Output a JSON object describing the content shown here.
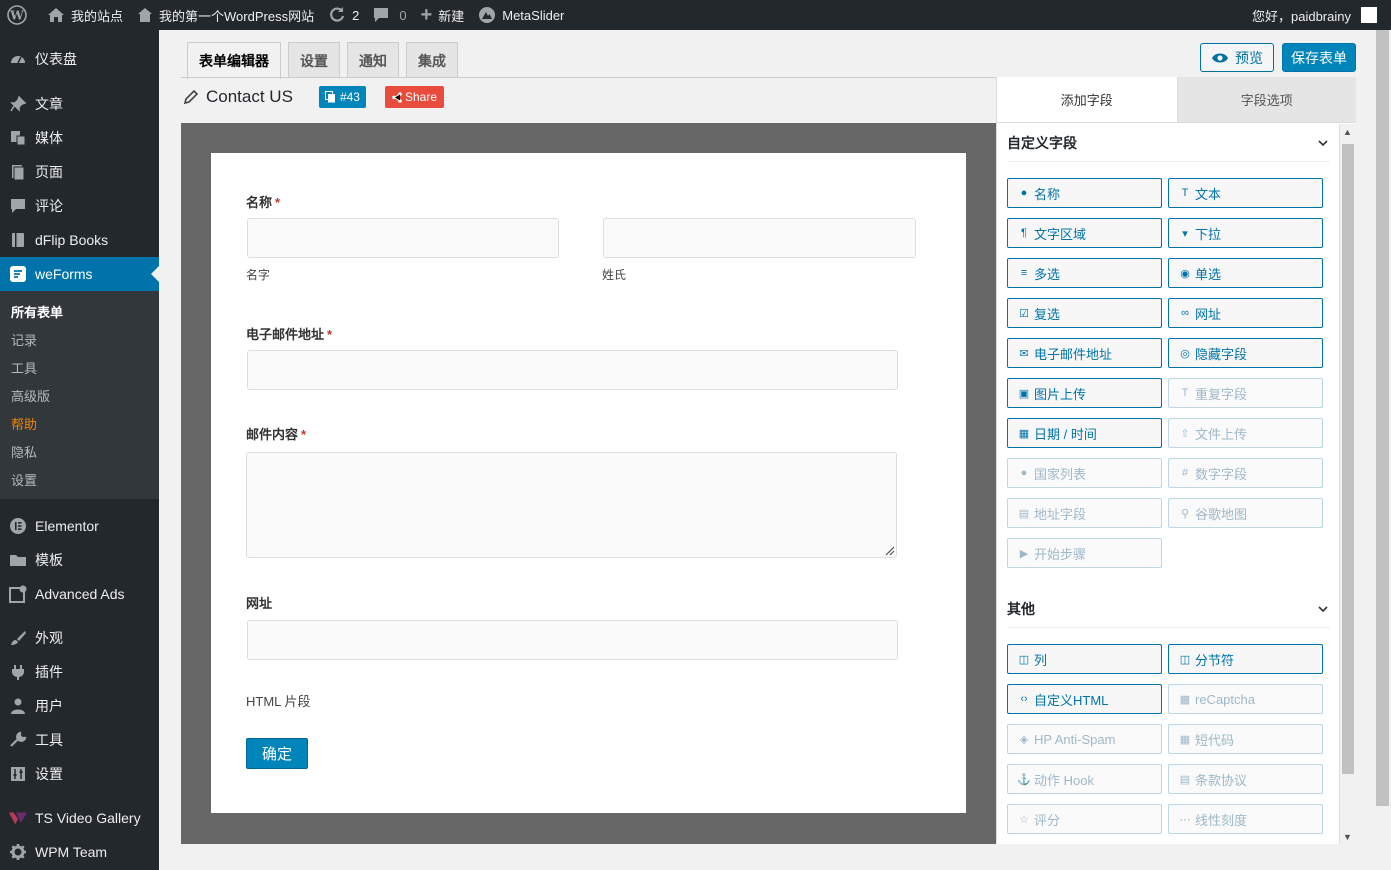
{
  "adminbar": {
    "site_name": "我的站点",
    "site_title": "我的第一个WordPress网站",
    "updates_count": "2",
    "comments_count": "0",
    "new_label": "新建",
    "plugin_label": "MetaSlider",
    "greeting": "您好，paidbrainy"
  },
  "sidebar": {
    "items_top": [
      {
        "label": "仪表盘",
        "icon": "dashboard-icon"
      }
    ],
    "items_mid": [
      {
        "label": "文章",
        "icon": "pin-icon"
      },
      {
        "label": "媒体",
        "icon": "media-icon"
      },
      {
        "label": "页面",
        "icon": "page-icon"
      },
      {
        "label": "评论",
        "icon": "comment-icon"
      },
      {
        "label": "dFlip Books",
        "icon": "book-icon"
      }
    ],
    "active": {
      "label": "weForms",
      "icon": "weforms-icon"
    },
    "submenu": [
      "所有表单",
      "记录",
      "工具",
      "高级版",
      "帮助",
      "隐私",
      "设置"
    ],
    "items_bottom1": [
      {
        "label": "Elementor",
        "icon": "elementor-icon"
      },
      {
        "label": "模板",
        "icon": "folder-icon"
      },
      {
        "label": "Advanced Ads",
        "icon": "ads-icon"
      }
    ],
    "items_bottom2": [
      {
        "label": "外观",
        "icon": "brush-icon"
      },
      {
        "label": "插件",
        "icon": "plugin-icon"
      },
      {
        "label": "用户",
        "icon": "user-icon"
      },
      {
        "label": "工具",
        "icon": "wrench-icon"
      },
      {
        "label": "设置",
        "icon": "settings-icon"
      }
    ],
    "items_bottom3": [
      {
        "label": "TS Video Gallery",
        "icon": "video-icon"
      },
      {
        "label": "WPM Team",
        "icon": "gear-icon"
      }
    ]
  },
  "editor": {
    "tabs": [
      "表单编辑器",
      "设置",
      "通知",
      "集成"
    ],
    "preview_label": "预览",
    "save_label": "保存表单",
    "form_title": "Contact US",
    "form_id": "#43",
    "share_label": "Share"
  },
  "form": {
    "name_label": "名称",
    "first_name_sub": "名字",
    "last_name_sub": "姓氏",
    "email_label": "电子邮件地址",
    "message_label": "邮件内容",
    "url_label": "网址",
    "html_label": "HTML 片段",
    "submit_label": "确定",
    "required_mark": "*"
  },
  "panel": {
    "tab_add": "添加字段",
    "tab_options": "字段选项",
    "section_custom": "自定义字段",
    "section_other": "其他",
    "custom_fields": [
      {
        "label": "名称",
        "icon": "user-icon",
        "enabled": true
      },
      {
        "label": "文本",
        "icon": "text-icon",
        "enabled": true
      },
      {
        "label": "文字区域",
        "icon": "paragraph-icon",
        "enabled": true
      },
      {
        "label": "下拉",
        "icon": "dropdown-icon",
        "enabled": true
      },
      {
        "label": "多选",
        "icon": "list-icon",
        "enabled": true
      },
      {
        "label": "单选",
        "icon": "radio-icon",
        "enabled": true
      },
      {
        "label": "复选",
        "icon": "checkbox-icon",
        "enabled": true
      },
      {
        "label": "网址",
        "icon": "link-icon",
        "enabled": true
      },
      {
        "label": "电子邮件地址",
        "icon": "envelope-icon",
        "enabled": true
      },
      {
        "label": "隐藏字段",
        "icon": "eye-slash-icon",
        "enabled": true
      },
      {
        "label": "图片上传",
        "icon": "image-icon",
        "enabled": true
      },
      {
        "label": "重复字段",
        "icon": "text-icon",
        "enabled": false
      },
      {
        "label": "日期 / 时间",
        "icon": "calendar-icon",
        "enabled": true
      },
      {
        "label": "文件上传",
        "icon": "upload-icon",
        "enabled": false
      },
      {
        "label": "国家列表",
        "icon": "globe-icon",
        "enabled": false
      },
      {
        "label": "数字字段",
        "icon": "hash-icon",
        "enabled": false
      },
      {
        "label": "地址字段",
        "icon": "address-card-icon",
        "enabled": false
      },
      {
        "label": "谷歌地图",
        "icon": "map-marker-icon",
        "enabled": false
      },
      {
        "label": "开始步骤",
        "icon": "step-icon",
        "enabled": false
      }
    ],
    "other_fields": [
      {
        "label": "列",
        "icon": "columns-icon",
        "enabled": true
      },
      {
        "label": "分节符",
        "icon": "columns-icon",
        "enabled": true
      },
      {
        "label": "自定义HTML",
        "icon": "code-icon",
        "enabled": true
      },
      {
        "label": "reCaptcha",
        "icon": "qrcode-icon",
        "enabled": false
      },
      {
        "label": "HP Anti-Spam",
        "icon": "shield-icon",
        "enabled": false
      },
      {
        "label": "短代码",
        "icon": "calendar-icon",
        "enabled": false
      },
      {
        "label": "动作 Hook",
        "icon": "anchor-icon",
        "enabled": false
      },
      {
        "label": "条款协议",
        "icon": "file-icon",
        "enabled": false
      },
      {
        "label": "评分",
        "icon": "star-icon",
        "enabled": false
      },
      {
        "label": "线性刻度",
        "icon": "ellipsis-icon",
        "enabled": false
      }
    ]
  },
  "colors": {
    "admin_dark": "#23282d",
    "accent": "#0073aa",
    "share_red": "#e74c3c",
    "help_orange": "#f18500"
  }
}
